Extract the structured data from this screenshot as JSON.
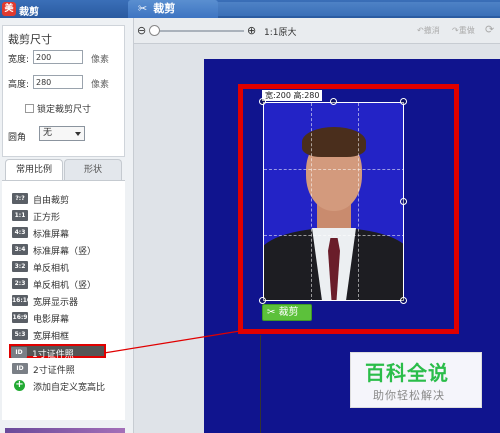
{
  "window": {
    "title": "裁剪",
    "app_icon_glyph": "美"
  },
  "active_tab": {
    "label": "裁剪",
    "icon": "scissors-icon"
  },
  "size_panel": {
    "header": "裁剪尺寸",
    "width_label": "宽度:",
    "width_value": "200",
    "height_label": "高度:",
    "height_value": "280",
    "unit": "像素",
    "lock_label": "锁定裁剪尺寸",
    "lock_checked": false,
    "corner_label": "圆角",
    "corner_value": "无"
  },
  "tabs": [
    {
      "label": "常用比例",
      "active": true
    },
    {
      "label": "形状",
      "active": false
    }
  ],
  "ratios": [
    {
      "icon": "?:?",
      "label": "自由裁剪"
    },
    {
      "icon": "1:1",
      "label": "正方形"
    },
    {
      "icon": "4:3",
      "label": "标准屏幕"
    },
    {
      "icon": "3:4",
      "label": "标准屏幕（竖）"
    },
    {
      "icon": "3:2",
      "label": "单反相机"
    },
    {
      "icon": "2:3",
      "label": "单反相机（竖）"
    },
    {
      "icon": "16:10",
      "label": "宽屏显示器"
    },
    {
      "icon": "16:9",
      "label": "电影屏幕"
    },
    {
      "icon": "5:3",
      "label": "宽屏相框"
    },
    {
      "icon": "ID",
      "label": "1寸证件照",
      "selected": true
    },
    {
      "icon": "ID",
      "label": "2寸证件照"
    },
    {
      "icon": "+",
      "label": "添加自定义宽高比"
    }
  ],
  "toolbar": {
    "zoom_out_icon": "zoom-out-icon",
    "zoom_in_icon": "zoom-in-icon",
    "one_to_one_label": "1:1原大",
    "undo_label": "撤消",
    "redo_label": "重做",
    "zoom_level": 0.0
  },
  "canvas": {
    "size_tag": "宽:200 高:280",
    "crop_button_label": "裁剪"
  },
  "watermark": {
    "title": "百科全说",
    "subtitle": "助你轻松解决"
  },
  "colors": {
    "titlebar": "#2a5aa0",
    "canvas_background": "#10148e",
    "photo_background": "#2323c6",
    "highlight_red": "#e00000",
    "crop_button": "#5cc13b",
    "watermark_green": "#2bbd4a"
  }
}
